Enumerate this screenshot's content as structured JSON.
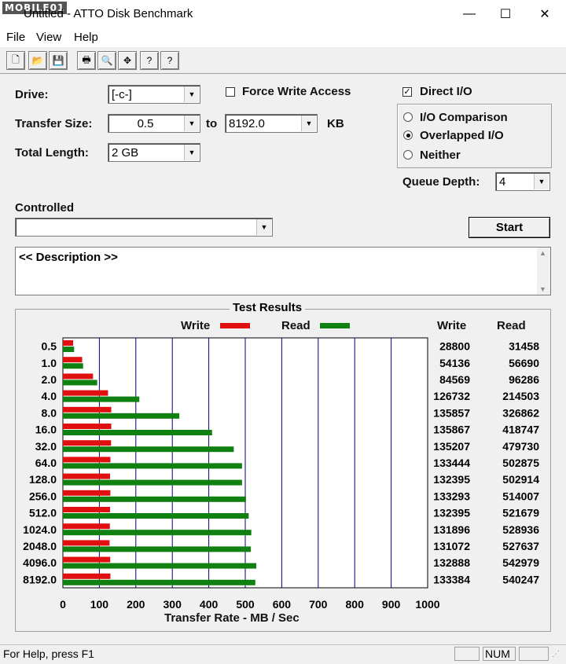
{
  "window": {
    "logo": "MOBILE01",
    "title": "Untitled - ATTO Disk Benchmark",
    "minimize": "—",
    "maximize": "☐",
    "close": "✕"
  },
  "menu": [
    "File",
    "View",
    "Help"
  ],
  "toolbar": [
    {
      "name": "new-icon",
      "glyph": "🗋"
    },
    {
      "name": "open-icon",
      "glyph": "📂"
    },
    {
      "name": "save-icon",
      "glyph": "💾"
    },
    {
      "name": "print-icon",
      "glyph": "🖶"
    },
    {
      "name": "print-preview-icon",
      "glyph": "🔍"
    },
    {
      "name": "move-icon",
      "glyph": "✥"
    },
    {
      "name": "help-icon",
      "glyph": "?"
    },
    {
      "name": "context-help-icon",
      "glyph": "?"
    }
  ],
  "form": {
    "drive_label": "Drive:",
    "drive_value": "[-c-]",
    "transfer_size_label": "Transfer Size:",
    "transfer_from": "0.5",
    "to_label": "to",
    "transfer_to": "8192.0",
    "kb_label": "KB",
    "total_length_label": "Total Length:",
    "total_length_value": "2 GB",
    "force_write_label": "Force Write Access",
    "force_write_checked": false,
    "direct_io_label": "Direct I/O",
    "direct_io_checked": true,
    "io_options": [
      {
        "label": "I/O Comparison",
        "selected": false
      },
      {
        "label": "Overlapped I/O",
        "selected": true
      },
      {
        "label": "Neither",
        "selected": false
      }
    ],
    "queue_depth_label": "Queue Depth:",
    "queue_depth_value": "4",
    "controlled_label": "Controlled",
    "controlled_value": "",
    "start_label": "Start",
    "description": "<< Description >>"
  },
  "results": {
    "title": "Test Results",
    "write_legend": "Write",
    "read_legend": "Read",
    "write_col": "Write",
    "read_col": "Read"
  },
  "chart_data": {
    "type": "bar",
    "orientation": "horizontal",
    "categories": [
      "0.5",
      "1.0",
      "2.0",
      "4.0",
      "8.0",
      "16.0",
      "32.0",
      "64.0",
      "128.0",
      "256.0",
      "512.0",
      "1024.0",
      "2048.0",
      "4096.0",
      "8192.0"
    ],
    "series": [
      {
        "name": "Write",
        "color": "#e01010",
        "values": [
          28800,
          54136,
          84569,
          126732,
          135857,
          135867,
          135207,
          133444,
          132395,
          133293,
          132395,
          131896,
          131072,
          132888,
          133384
        ]
      },
      {
        "name": "Read",
        "color": "#108010",
        "values": [
          31458,
          56690,
          96286,
          214503,
          326862,
          418747,
          479730,
          502875,
          502914,
          514007,
          521679,
          528936,
          527637,
          542979,
          540247
        ]
      }
    ],
    "xticks": [
      "0",
      "100",
      "200",
      "300",
      "400",
      "500",
      "600",
      "700",
      "800",
      "900",
      "1000"
    ],
    "xlim": [
      0,
      1000
    ],
    "xlabel": "Transfer Rate - MB / Sec",
    "grid": true
  },
  "status": {
    "help_text": "For Help, press F1",
    "num": "NUM"
  }
}
